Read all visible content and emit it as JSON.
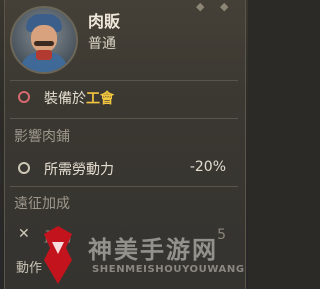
{
  "unit": {
    "name": "肉販",
    "rank": "普通"
  },
  "equip": {
    "prefix": "裝備於",
    "target": "工會"
  },
  "section1": {
    "title": "影響肉鋪"
  },
  "stat1": {
    "label": "所需勞動力",
    "value": "-20%"
  },
  "section2": {
    "title": "遠征加成"
  },
  "stat2": {
    "label": "武力",
    "value": "5"
  },
  "footer": {
    "label": "動作"
  },
  "watermark": {
    "text": "神美手游网",
    "sub": "SHENMEISHOUYOUWANG"
  },
  "colors": {
    "highlight": "#f1c540",
    "negative_icon": "#d66a6f",
    "panel": "#3b3832"
  }
}
